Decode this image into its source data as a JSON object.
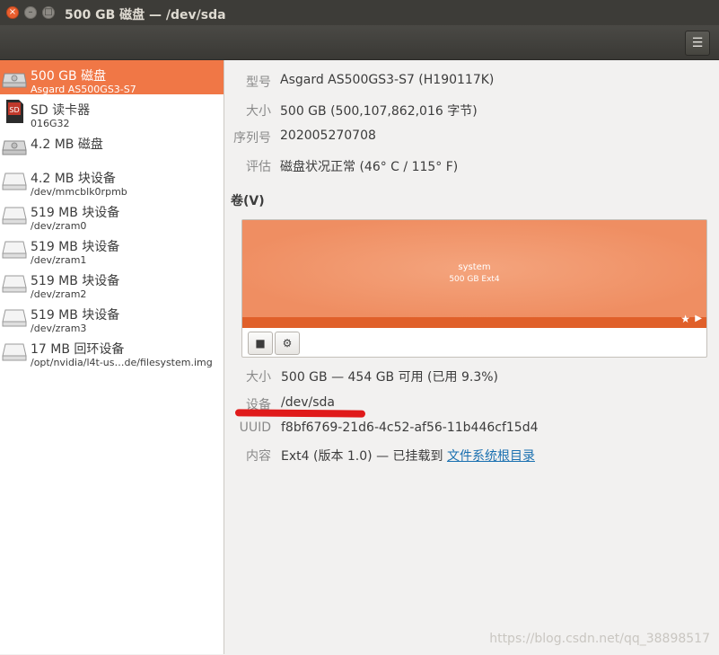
{
  "window": {
    "title": "500 GB 磁盘 — /dev/sda",
    "close_glyph": "×",
    "min_glyph": "–",
    "max_glyph": "□"
  },
  "toolbar": {
    "menu_glyph": "☰"
  },
  "sidebar": {
    "items": [
      {
        "label": "500 GB 磁盘",
        "sub": "Asgard AS500GS3-S7",
        "icon": "hard-disk-icon",
        "selected": true
      },
      {
        "label": "SD 读卡器",
        "sub": "016G32",
        "icon": "sd-card-icon"
      },
      {
        "label": "4.2 MB 磁盘",
        "sub": "",
        "icon": "hard-disk-icon"
      },
      {
        "label": "4.2 MB 块设备",
        "sub": "/dev/mmcblk0rpmb",
        "icon": "block-device-icon"
      },
      {
        "label": "519 MB 块设备",
        "sub": "/dev/zram0",
        "icon": "block-device-icon"
      },
      {
        "label": "519 MB 块设备",
        "sub": "/dev/zram1",
        "icon": "block-device-icon"
      },
      {
        "label": "519 MB 块设备",
        "sub": "/dev/zram2",
        "icon": "block-device-icon"
      },
      {
        "label": "519 MB 块设备",
        "sub": "/dev/zram3",
        "icon": "block-device-icon"
      },
      {
        "label": "17 MB 回环设备",
        "sub": "/opt/nvidia/l4t-us…de/filesystem.img",
        "icon": "block-device-icon"
      }
    ]
  },
  "drive": {
    "model_label": "型号",
    "model": "Asgard AS500GS3-S7 (H190117K)",
    "size_label": "大小",
    "size": "500 GB (500,107,862,016 字节)",
    "serial_label": "序列号",
    "serial": "202005270708",
    "assessment_label": "评估",
    "assessment": "磁盘状况正常 (46° C / 115° F)"
  },
  "volumes": {
    "heading": "卷(V)",
    "partition": {
      "name": "system",
      "size": "500 GB Ext4"
    },
    "stop_glyph": "■",
    "gear_glyph": "⚙",
    "star_glyph": "★",
    "play_glyph": "▶"
  },
  "volume_info": {
    "size_label": "大小",
    "size": "500 GB — 454 GB 可用 (已用 9.3%)",
    "device_label": "设备",
    "device": "/dev/sda",
    "uuid_label": "UUID",
    "uuid": "f8bf6769-21d6-4c52-af56-11b446cf15d4",
    "contents_label": "内容",
    "contents_prefix": "Ext4 (版本 1.0) — 已挂载到 ",
    "contents_link": "文件系统根目录"
  },
  "watermark": "https://blog.csdn.net/qq_38898517",
  "colors": {
    "accent": "#f07746",
    "partition": "#ef8e62",
    "partition_strip": "#e0602a",
    "annotation": "#e01a1a"
  }
}
